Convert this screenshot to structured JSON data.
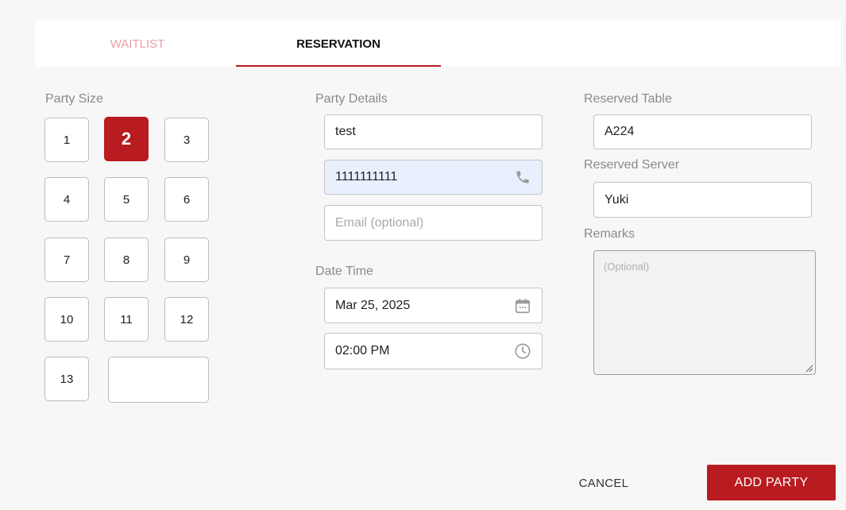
{
  "tabs": [
    {
      "label": "WAITLIST",
      "active": false
    },
    {
      "label": "RESERVATION",
      "active": true
    }
  ],
  "party_size": {
    "label": "Party Size",
    "options": [
      "1",
      "2",
      "3",
      "4",
      "5",
      "6",
      "7",
      "8",
      "9",
      "10",
      "11",
      "12",
      "13"
    ],
    "selected": "2",
    "custom_value": ""
  },
  "party_details": {
    "label": "Party Details",
    "name_value": "test",
    "phone_value": "1111111111",
    "email_value": "",
    "email_placeholder": "Email (optional)"
  },
  "date_time": {
    "label": "Date Time",
    "date_value": "Mar 25, 2025",
    "time_value": "02:00 PM"
  },
  "reserved_table": {
    "label": "Reserved Table",
    "value": "A224"
  },
  "reserved_server": {
    "label": "Reserved Server",
    "value": "Yuki"
  },
  "remarks": {
    "label": "Remarks",
    "placeholder": "(Optional)",
    "value": ""
  },
  "actions": {
    "cancel_label": "CANCEL",
    "add_label": "ADD PARTY"
  },
  "colors": {
    "accent": "#b81b20",
    "tab_inactive": "#e8a0a5",
    "highlight_field": "#e8effd"
  }
}
